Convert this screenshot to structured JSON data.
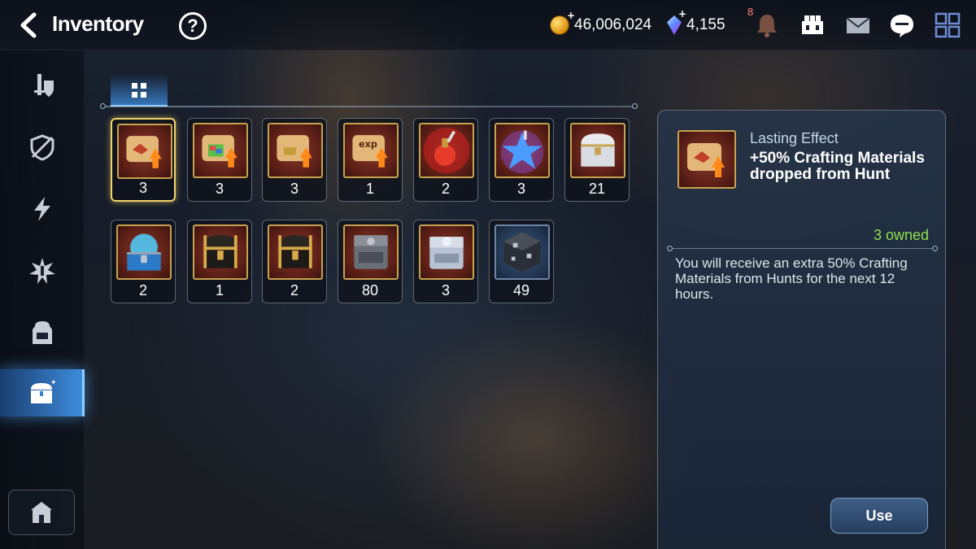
{
  "header": {
    "title": "Inventory",
    "help_glyph": "?",
    "gold": "46,006,024",
    "crystals": "4,155",
    "notification_count": "8"
  },
  "sidebar": {
    "items": [
      {
        "icon": "hero-icon"
      },
      {
        "icon": "no-shield-icon"
      },
      {
        "icon": "lightning-icon"
      },
      {
        "icon": "burst-icon"
      },
      {
        "icon": "backpack-icon"
      },
      {
        "icon": "treasure-chest-icon",
        "active": true
      }
    ],
    "home_icon": "castle-home-icon"
  },
  "tabs": [
    {
      "icon": "grid-icon",
      "active": true
    }
  ],
  "items": [
    {
      "icon": "scroll-crafting-icon",
      "count": "3",
      "selected": true
    },
    {
      "icon": "scroll-rainbow-icon",
      "count": "3"
    },
    {
      "icon": "scroll-gold-icon",
      "count": "3"
    },
    {
      "icon": "scroll-exp-icon",
      "count": "1"
    },
    {
      "icon": "red-potion-icon",
      "count": "2"
    },
    {
      "icon": "blue-star-icon",
      "count": "3"
    },
    {
      "icon": "silver-chest-icon",
      "count": "21"
    },
    {
      "icon": "blue-chest-icon",
      "count": "2"
    },
    {
      "icon": "black-gold-chest-icon",
      "count": "1"
    },
    {
      "icon": "black-gold-chest-icon",
      "count": "2"
    },
    {
      "icon": "steel-box-icon",
      "count": "80"
    },
    {
      "icon": "silver-box-icon",
      "count": "3"
    },
    {
      "icon": "dark-cube-icon",
      "count": "49"
    }
  ],
  "detail": {
    "type": "Lasting Effect",
    "name": "+50% Crafting Materials dropped from Hunt",
    "owned": "3 owned",
    "description": "You will receive an extra 50% Crafting Materials from Hunts for the next 12 hours.",
    "use_label": "Use"
  }
}
